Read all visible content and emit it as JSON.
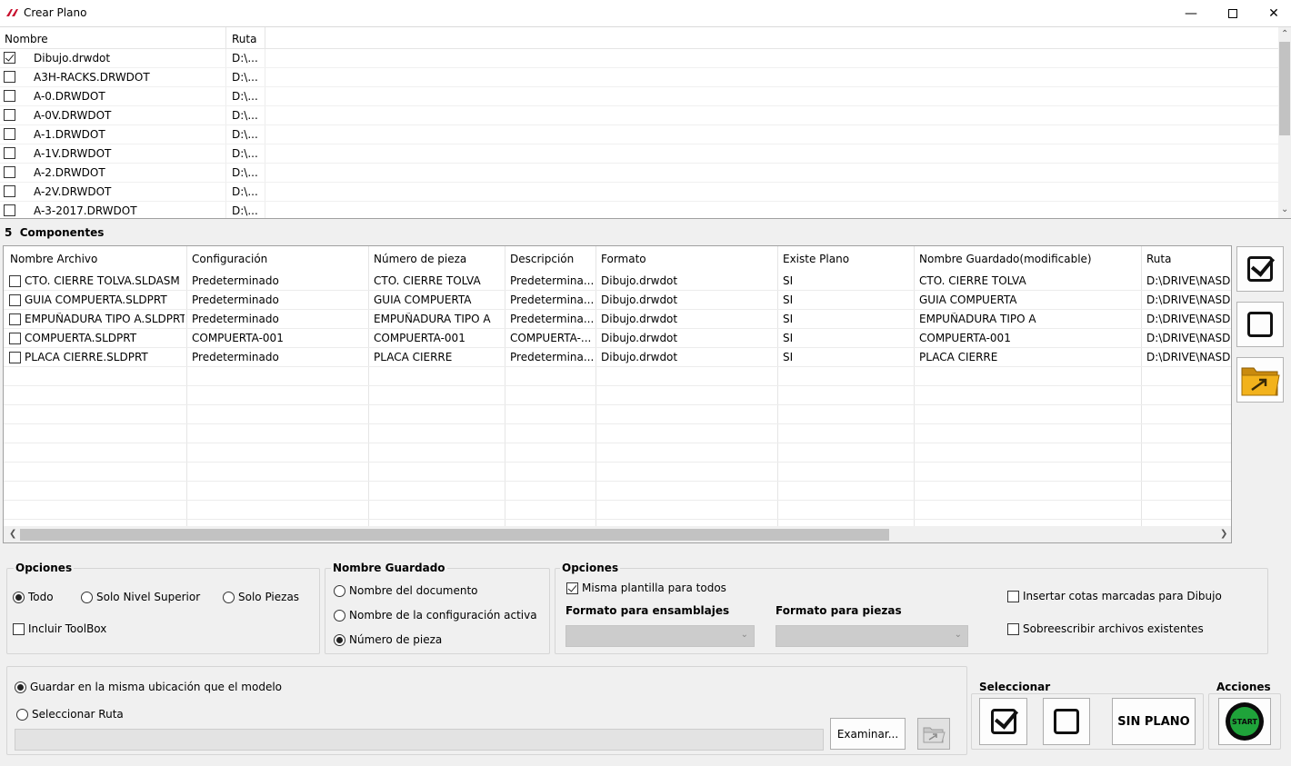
{
  "window": {
    "title": "Crear Plano",
    "minimize_icon": "minimize-icon",
    "maximize_icon": "maximize-icon",
    "close_icon": "close-icon"
  },
  "templates": {
    "headers": {
      "name": "Nombre",
      "path": "Ruta"
    },
    "rows": [
      {
        "checked": true,
        "name": "Dibujo.drwdot",
        "path": "D:\\..."
      },
      {
        "checked": false,
        "name": "A3H-RACKS.DRWDOT",
        "path": "D:\\..."
      },
      {
        "checked": false,
        "name": "A-0.DRWDOT",
        "path": "D:\\..."
      },
      {
        "checked": false,
        "name": "A-0V.DRWDOT",
        "path": "D:\\..."
      },
      {
        "checked": false,
        "name": "A-1.DRWDOT",
        "path": "D:\\..."
      },
      {
        "checked": false,
        "name": "A-1V.DRWDOT",
        "path": "D:\\..."
      },
      {
        "checked": false,
        "name": "A-2.DRWDOT",
        "path": "D:\\..."
      },
      {
        "checked": false,
        "name": "A-2V.DRWDOT",
        "path": "D:\\..."
      },
      {
        "checked": false,
        "name": "A-3-2017.DRWDOT",
        "path": "D:\\..."
      }
    ]
  },
  "components": {
    "count": "5",
    "label": "Componentes",
    "headers": {
      "file": "Nombre Archivo",
      "config": "Configuración",
      "part": "Número de pieza",
      "desc": "Descripción",
      "format": "Formato",
      "exists": "Existe Plano",
      "saved": "Nombre Guardado(modificable)",
      "path": "Ruta"
    },
    "rows": [
      {
        "file": "CTO. CIERRE TOLVA.SLDASM",
        "config": "Predeterminado",
        "part": "CTO. CIERRE TOLVA",
        "desc": "Predetermina...",
        "format": "Dibujo.drwdot",
        "exists": "SI",
        "saved": "CTO. CIERRE TOLVA",
        "path": "D:\\DRIVE\\NASD..."
      },
      {
        "file": "GUIA COMPUERTA.SLDPRT",
        "config": "Predeterminado",
        "part": "GUIA COMPUERTA",
        "desc": "Predetermina...",
        "format": "Dibujo.drwdot",
        "exists": "SI",
        "saved": "GUIA COMPUERTA",
        "path": "D:\\DRIVE\\NASD..."
      },
      {
        "file": "EMPUÑADURA TIPO A.SLDPRT",
        "config": "Predeterminado",
        "part": "EMPUÑADURA TIPO A",
        "desc": "Predetermina...",
        "format": "Dibujo.drwdot",
        "exists": "SI",
        "saved": "EMPUÑADURA TIPO A",
        "path": "D:\\DRIVE\\NASD..."
      },
      {
        "file": "COMPUERTA.SLDPRT",
        "config": "COMPUERTA-001",
        "part": "COMPUERTA-001",
        "desc": "COMPUERTA-...",
        "format": "Dibujo.drwdot",
        "exists": "SI",
        "saved": "COMPUERTA-001",
        "path": "D:\\DRIVE\\NASD..."
      },
      {
        "file": "PLACA CIERRE.SLDPRT",
        "config": "Predeterminado",
        "part": "PLACA CIERRE",
        "desc": "Predetermina...",
        "format": "Dibujo.drwdot",
        "exists": "SI",
        "saved": "PLACA CIERRE",
        "path": "D:\\DRIVE\\NASD..."
      }
    ]
  },
  "side_buttons": {
    "select_all_icon": "checkbox-checked-icon",
    "deselect_all_icon": "checkbox-empty-icon",
    "open_folder_icon": "folder-arrow-icon"
  },
  "options1": {
    "title": "Opciones",
    "all": "Todo",
    "top_level": "Solo Nivel Superior",
    "parts_only": "Solo Piezas",
    "include_toolbox": "Incluir ToolBox",
    "selected": "all",
    "include_toolbox_checked": false
  },
  "saved_name": {
    "title": "Nombre Guardado",
    "doc_name": "Nombre del documento",
    "active_config": "Nombre de la configuración activa",
    "part_number": "Número de pieza",
    "selected": "part_number"
  },
  "options2": {
    "title": "Opciones",
    "same_template": "Misma plantilla para todos",
    "same_template_checked": true,
    "assembly_format_label": "Formato para ensamblajes",
    "assembly_format_value": "",
    "part_format_label": "Formato para piezas",
    "part_format_value": "",
    "insert_dims": "Insertar cotas marcadas para Dibujo",
    "overwrite": "Sobreescribir archivos existentes"
  },
  "save_location": {
    "same_as_model": "Guardar en la misma ubicación  que el modelo",
    "select_path": "Seleccionar Ruta",
    "path_value": "",
    "browse": "Examinar...",
    "selected": "same_as_model"
  },
  "select": {
    "title": "Seleccionar",
    "no_drawing": "SIN PLANO"
  },
  "actions": {
    "title": "Acciones",
    "start": "START"
  },
  "colors": {
    "start_green": "#1fa33a",
    "start_ring": "#0b0b0b",
    "folder_yellow": "#f2b21c"
  }
}
